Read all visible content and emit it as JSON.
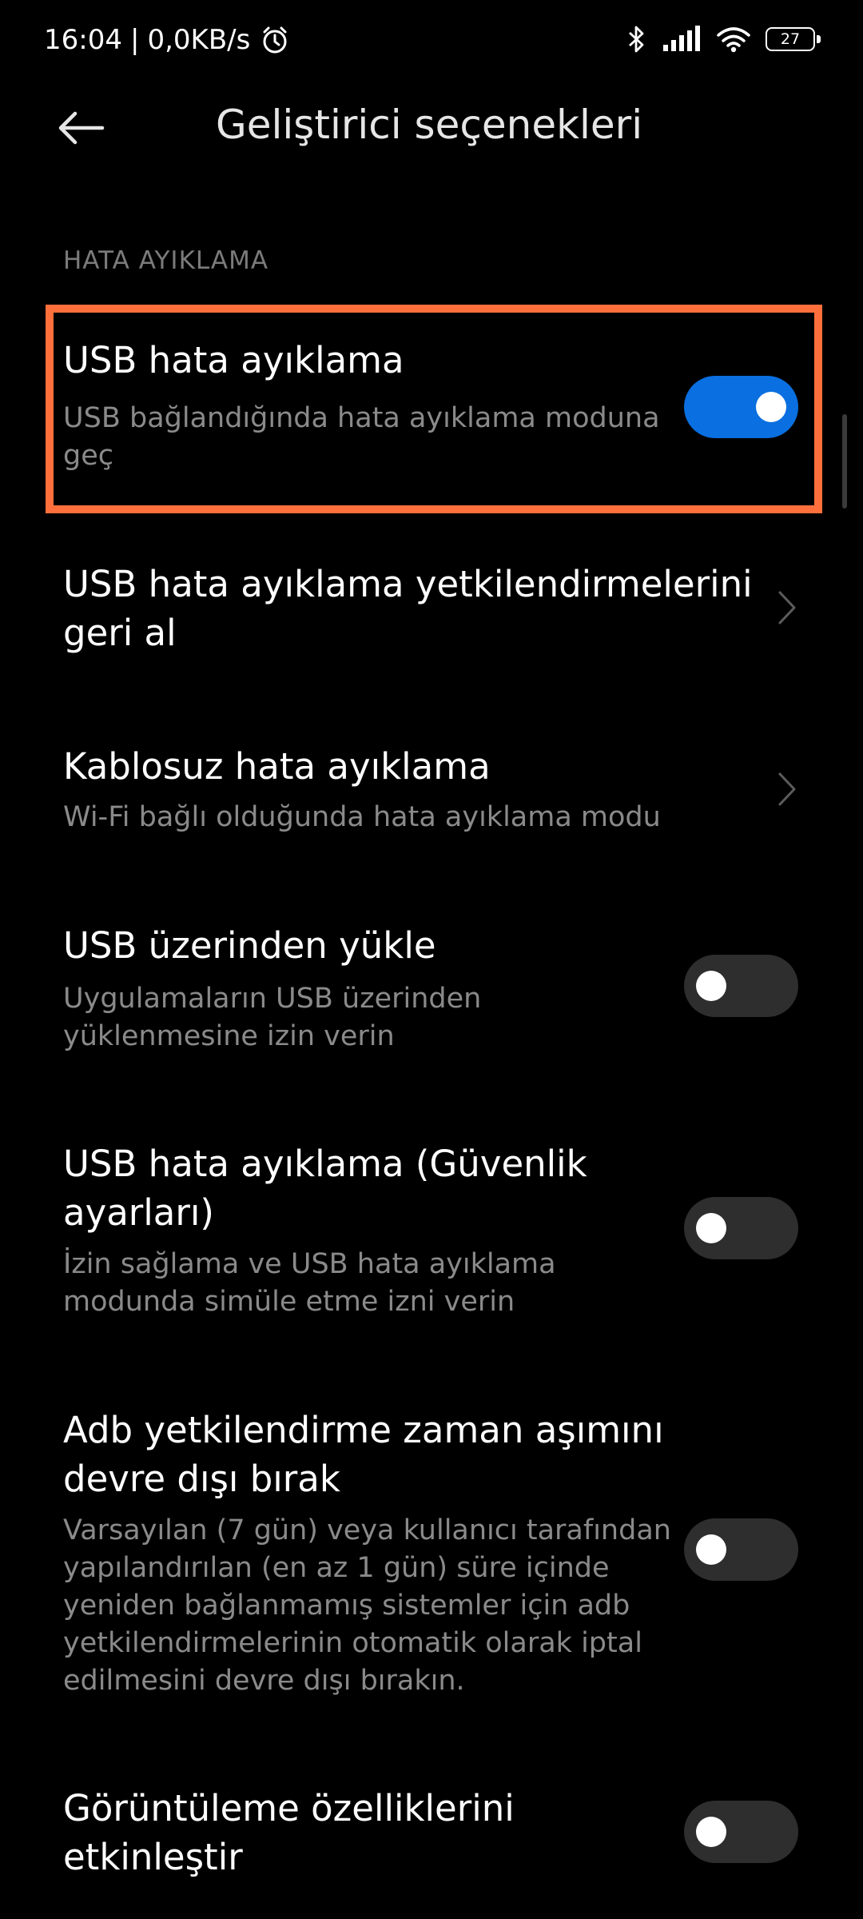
{
  "status_bar": {
    "time": "16:04",
    "separator": "|",
    "net_speed": "0,0KB/s",
    "battery_level": "27",
    "icons": [
      "alarm-icon",
      "bluetooth-icon",
      "signal-icon",
      "wifi-icon",
      "battery-icon"
    ]
  },
  "header": {
    "back_icon": "arrow-left-icon",
    "title": "Geliştirici seçenekleri"
  },
  "section": {
    "label": "HATA AYIKLAMA"
  },
  "settings": [
    {
      "title": "USB hata ayıklama",
      "desc_lines": [
        "USB bağlandığında hata ayıklama moduna",
        "geç"
      ],
      "control": "toggle",
      "enabled": true
    },
    {
      "title_lines": [
        "USB hata ayıklama yetkilendirmelerini",
        "geri al"
      ],
      "control": "chevron"
    },
    {
      "title": "Kablosuz hata ayıklama",
      "desc_lines": [
        "Wi-Fi bağlı olduğunda hata ayıklama modu"
      ],
      "control": "chevron"
    },
    {
      "title": "USB üzerinden yükle",
      "desc_lines": [
        "Uygulamaların USB üzerinden",
        "yüklenmesine izin verin"
      ],
      "control": "toggle",
      "enabled": false
    },
    {
      "title_lines": [
        "USB hata ayıklama (Güvenlik",
        "ayarları)"
      ],
      "desc_lines": [
        "İzin sağlama ve USB hata ayıklama",
        "modunda simüle etme izni verin"
      ],
      "control": "toggle",
      "enabled": false
    },
    {
      "title_lines": [
        "Adb yetkilendirme zaman aşımını",
        "devre dışı bırak"
      ],
      "desc_lines": [
        "Varsayılan (7 gün) veya kullanıcı tarafından",
        "yapılandırılan (en az 1 gün) süre içinde",
        "yeniden bağlanmamış sistemler için adb",
        "yetkilendirmelerinin otomatik olarak iptal",
        "edilmesini devre dışı bırakın."
      ],
      "control": "toggle",
      "enabled": false
    },
    {
      "title_lines": [
        "Görüntüleme özelliklerini",
        "etkinleştir"
      ],
      "control": "toggle",
      "enabled": false
    }
  ],
  "colors": {
    "background": "#000000",
    "toggle_on": "#0a6fe0",
    "toggle_off": "#2e2e2e",
    "highlight": "#ff6f3c",
    "secondary_text": "#8a8a8a"
  }
}
